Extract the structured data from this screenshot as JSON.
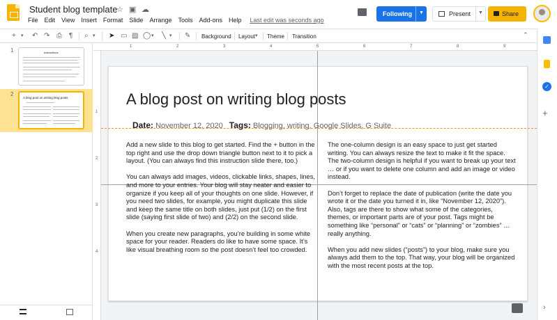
{
  "header": {
    "title": "Student blog template",
    "menus": [
      "File",
      "Edit",
      "View",
      "Insert",
      "Format",
      "Slide",
      "Arrange",
      "Tools",
      "Add-ons",
      "Help"
    ],
    "last_edit": "Last edit was seconds ago",
    "following_label": "Following",
    "present_label": "Present",
    "share_label": "Share",
    "icons": [
      "star-icon",
      "move-folder-icon",
      "cloud-saved-icon",
      "comments-icon",
      "account-avatar"
    ]
  },
  "toolbar": {
    "background_label": "Background",
    "layout_label": "Layout",
    "theme_label": "Theme",
    "transition_label": "Transition"
  },
  "filmstrip": {
    "slides": [
      {
        "number": "1",
        "title": "Instructions"
      },
      {
        "number": "2",
        "title": "A blog post on writing blog posts"
      }
    ]
  },
  "rulers": {
    "top": [
      "1",
      "2",
      "3",
      "4",
      "5",
      "6",
      "7",
      "8",
      "9"
    ],
    "left": [
      "1",
      "2",
      "3",
      "4"
    ]
  },
  "slide": {
    "title": "A blog post on writing blog posts",
    "date_label": "Date:",
    "date_value": "November 12, 2020",
    "tags_label": "Tags:",
    "tags_value": "Blogging, writing, Google Slides, G Suite",
    "left_column": [
      "Add a new slide to this blog to get started. Find the + button in the top right and use the drop down triangle button next to it to pick a layout. (You can always find this instruction slide there, too.)",
      "You can always add images, videos, clickable links, shapes, lines, and more to your entries. Your blog will stay neater and easier to organize if you keep all of your thoughts on one slide. However, if you need two slides, for example, you might duplicate this slide and keep the same title on both slides, just put (1/2) on the first slide (saying first slide of two) and (2/2) on the second slide.",
      "When you create new paragraphs, you’re building in some white space for your reader. Readers do like to have some space. It’s like visual breathing room so the post doesn’t feel too crowded."
    ],
    "right_column": [
      "The one-column design is an easy space to just get started writing. You can always resize the text to make it fit the space. The two-column design is helpful if you want to break up your text … or if you want to delete one column and add an image or video instead.",
      "Don’t forget to replace the date of publication (write the date you wrote it or the date you turned it in, like “November 12, 2020”). Also, tags are there to show what some of the categories, themes, or important parts are of your post. Tags might be something like “personal” or “cats” or “planning” or “zombies” … really anything.",
      "When you add new slides (“posts”) to your blog, make sure you always add them to the top. That way, your blog will be organized with the most recent posts at the top."
    ]
  },
  "colors": {
    "accent_blue": "#1a73e8",
    "slides_yellow": "#f4b400",
    "selected_thumb_bg": "#fde293"
  }
}
